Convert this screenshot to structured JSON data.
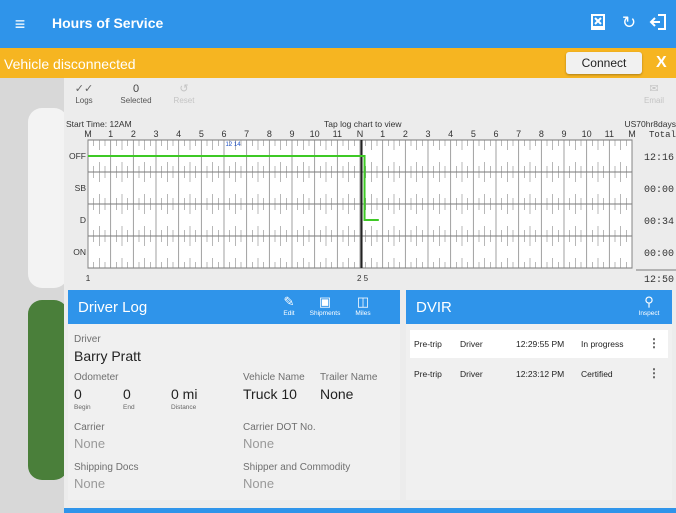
{
  "header": {
    "title": "Hours of Service",
    "menu_icon": "menu-icon",
    "icons": [
      "vehicle-inspect-icon",
      "refresh-icon",
      "logout-icon"
    ]
  },
  "banner": {
    "message": "Vehicle disconnected",
    "connect_label": "Connect",
    "close_label": "X",
    "color": "#f6b521"
  },
  "toolbar": {
    "logs_label": "Logs",
    "selected_count": "0",
    "selected_label": "Selected",
    "reset_label": "Reset",
    "email_label": "Email",
    "start_time": "Start Time: 12AM",
    "tap_hint": "Tap log chart to view",
    "ruleset": "US70hr8days"
  },
  "chart_data": {
    "type": "step-line",
    "hour_labels": [
      "M",
      "1",
      "2",
      "3",
      "4",
      "5",
      "6",
      "7",
      "8",
      "9",
      "10",
      "11",
      "N",
      "1",
      "2",
      "3",
      "4",
      "5",
      "6",
      "7",
      "8",
      "9",
      "10",
      "11",
      "M"
    ],
    "rows": [
      "OFF",
      "SB",
      "D",
      "ON"
    ],
    "total_label": "Total",
    "totals": [
      "12:16",
      "00:00",
      "00:34",
      "00:00"
    ],
    "grand_total": "12:50",
    "segments": [
      {
        "status": "OFF",
        "start": 0,
        "end": 12.2
      },
      {
        "status": "D",
        "start": 12.2,
        "end": 12.83
      }
    ],
    "color": "#3ec925",
    "marker_label": "12 14",
    "bottom_left_label": "1",
    "bottom_mid_label": "2 5"
  },
  "driver_log": {
    "title": "Driver Log",
    "edit_label": "Edit",
    "shipments_label": "Shipments",
    "miles_label": "Miles",
    "driver_label": "Driver",
    "driver_name": "Barry Pratt",
    "odometer_label": "Odometer",
    "begin_value": "0",
    "begin_label": "Begin",
    "end_value": "0",
    "end_label": "End",
    "distance_value": "0 mi",
    "distance_label": "Distance",
    "vehicle_name_label": "Vehicle Name",
    "vehicle_name": "Truck 10",
    "trailer_name_label": "Trailer Name",
    "trailer_name": "None",
    "carrier_label": "Carrier",
    "carrier": "None",
    "carrier_dot_label": "Carrier DOT No.",
    "carrier_dot": "None",
    "shipping_docs_label": "Shipping Docs",
    "shipping_docs": "None",
    "shipper_label": "Shipper and Commodity",
    "shipper": "None"
  },
  "dvir": {
    "title": "DVIR",
    "inspect_label": "Inspect",
    "rows": [
      {
        "type": "Pre-trip",
        "role": "Driver",
        "time": "12:29:55 PM",
        "status": "In progress"
      },
      {
        "type": "Pre-trip",
        "role": "Driver",
        "time": "12:23:12 PM",
        "status": "Certified"
      }
    ]
  },
  "colors": {
    "primary": "#2f94ea",
    "warning": "#f6b521",
    "chart_line": "#3ec925"
  }
}
